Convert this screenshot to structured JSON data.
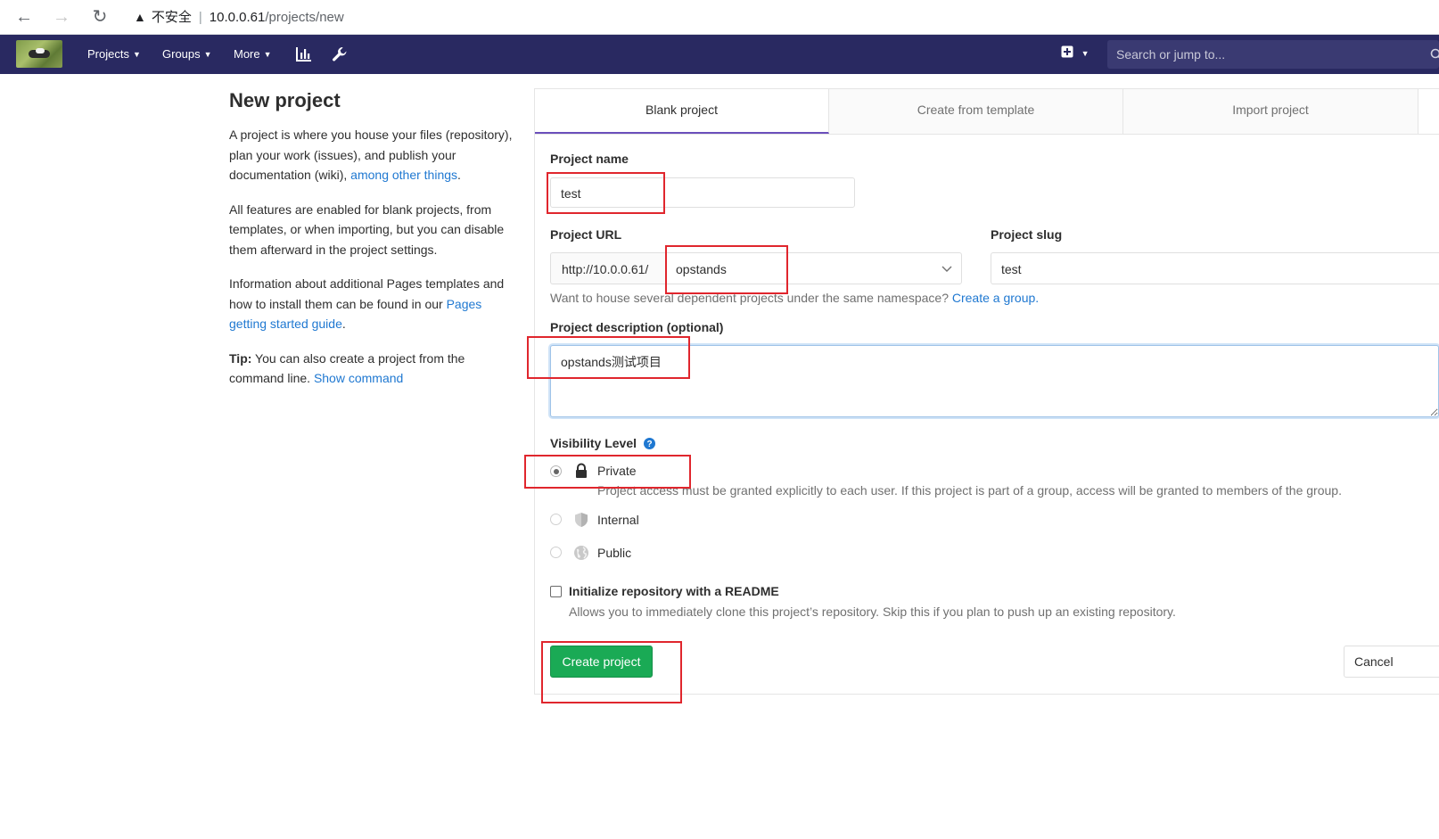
{
  "browser": {
    "security_label": "不安全",
    "url_host": "10.0.0.61",
    "url_path": "/projects/new"
  },
  "header": {
    "menu": [
      {
        "label": "Projects"
      },
      {
        "label": "Groups"
      },
      {
        "label": "More"
      }
    ],
    "search_placeholder": "Search or jump to..."
  },
  "sidebar": {
    "title": "New project",
    "p1_text": "A project is where you house your files (repository), plan your work (issues), and publish your documentation (wiki), ",
    "p1_link": "among other things",
    "p1_end": ".",
    "p2_text": "All features are enabled for blank projects, from templates, or when importing, but you can disable them afterward in the project settings.",
    "p3_text": "Information about additional Pages templates and how to install them can be found in our ",
    "p3_link": "Pages getting started guide",
    "p3_end": ".",
    "tip_label": "Tip:",
    "tip_text": " You can also create a project from the command line. ",
    "tip_link": "Show command"
  },
  "tabs": [
    {
      "label": "Blank project",
      "active": true
    },
    {
      "label": "Create from template",
      "active": false
    },
    {
      "label": "Import project",
      "active": false
    }
  ],
  "form": {
    "project_name_label": "Project name",
    "project_name_value": "test",
    "project_url_label": "Project URL",
    "url_prefix": "http://10.0.0.61/",
    "namespace_value": "opstands",
    "project_slug_label": "Project slug",
    "project_slug_value": "test",
    "namespace_help": "Want to house several dependent projects under the same namespace? ",
    "namespace_help_link": "Create a group.",
    "description_label": "Project description (optional)",
    "description_value": "opstands测试项目",
    "visibility_label": "Visibility Level",
    "visibility_options": [
      {
        "label": "Private",
        "description": "Project access must be granted explicitly to each user. If this project is part of a group, access will be granted to members of the group.",
        "selected": true,
        "icon": "lock-icon"
      },
      {
        "label": "Internal",
        "selected": false,
        "icon": "shield-icon"
      },
      {
        "label": "Public",
        "selected": false,
        "icon": "globe-icon"
      }
    ],
    "readme_label": "Initialize repository with a README",
    "readme_help": "Allows you to immediately clone this project’s repository. Skip this if you plan to push up an existing repository.",
    "readme_checked": false,
    "create_button": "Create project",
    "cancel_button": "Cancel"
  },
  "colors": {
    "header_bg": "#292961",
    "link": "#1f78d1",
    "create_button": "#1aaa55",
    "active_tab_border": "#6b4fbb",
    "annotation": "#e0262d"
  }
}
